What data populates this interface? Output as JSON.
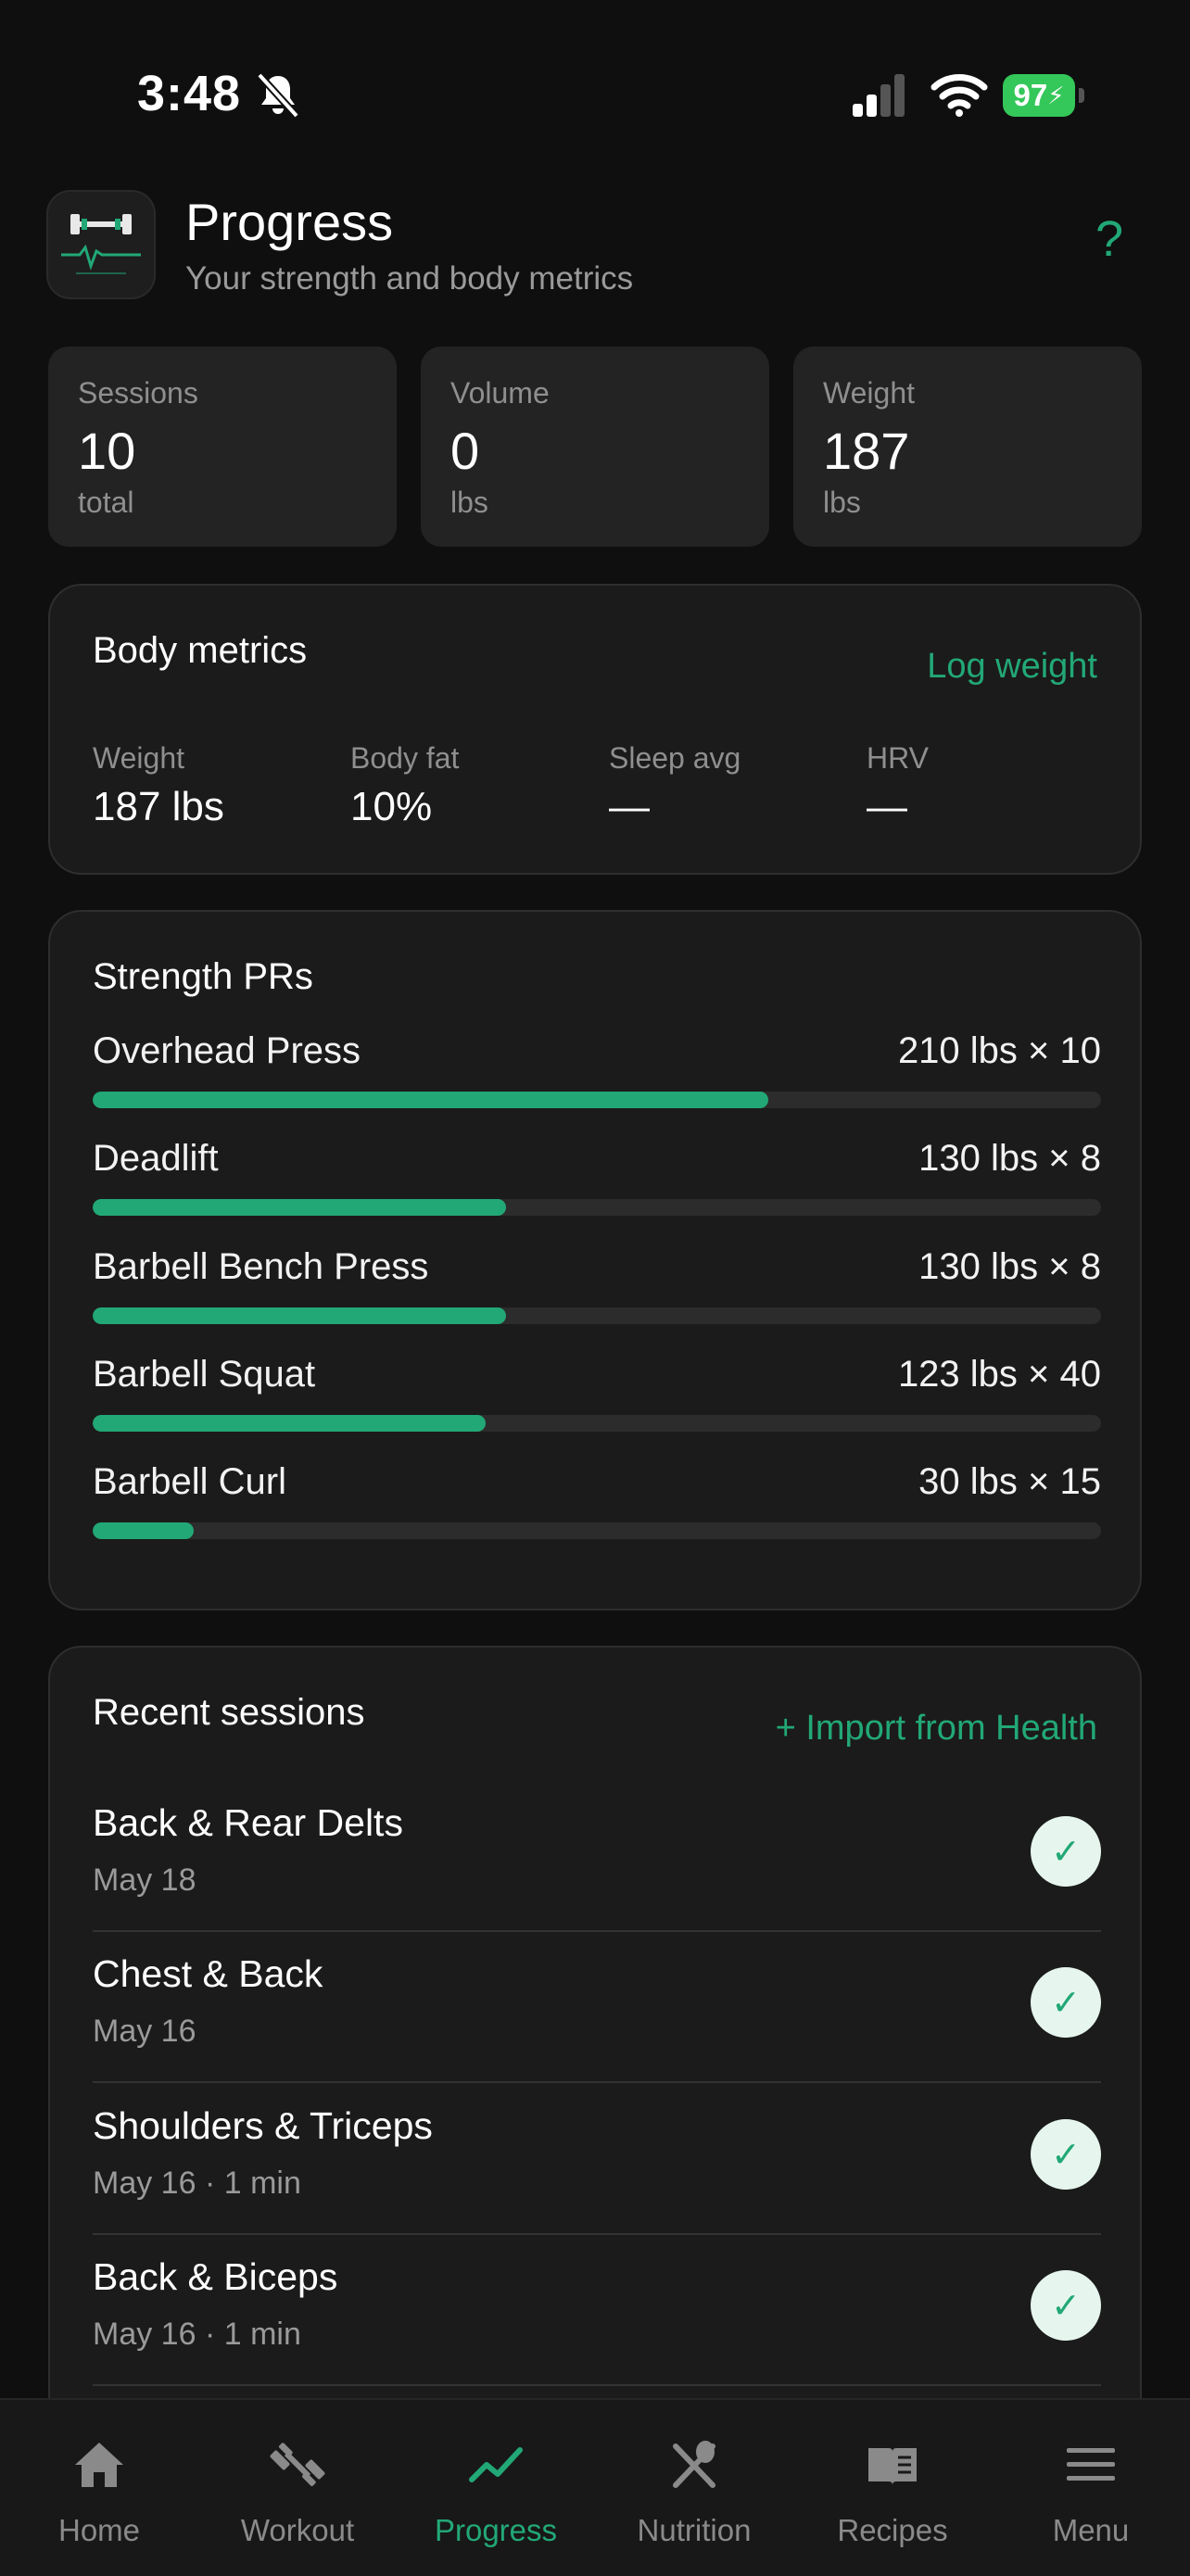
{
  "status_bar": {
    "time": "3:48",
    "battery": "97"
  },
  "header": {
    "title": "Progress",
    "subtitle": "Your strength and body metrics",
    "help": "?"
  },
  "stats": [
    {
      "label": "Sessions",
      "value": "10",
      "unit": "total"
    },
    {
      "label": "Volume",
      "value": "0",
      "unit": "lbs"
    },
    {
      "label": "Weight",
      "value": "187",
      "unit": "lbs"
    }
  ],
  "body_metrics": {
    "title": "Body metrics",
    "action": "Log weight",
    "items": [
      {
        "label": "Weight",
        "value": "187 lbs"
      },
      {
        "label": "Body fat",
        "value": "10%"
      },
      {
        "label": "Sleep avg",
        "value": "—"
      },
      {
        "label": "HRV",
        "value": "—"
      }
    ]
  },
  "strength_prs": {
    "title": "Strength PRs",
    "items": [
      {
        "name": "Overhead Press",
        "value": "210 lbs × 10",
        "progress": 0.67
      },
      {
        "name": "Deadlift",
        "value": "130 lbs × 8",
        "progress": 0.41
      },
      {
        "name": "Barbell Bench Press",
        "value": "130 lbs × 8",
        "progress": 0.41
      },
      {
        "name": "Barbell Squat",
        "value": "123 lbs × 40",
        "progress": 0.39
      },
      {
        "name": "Barbell Curl",
        "value": "30 lbs × 15",
        "progress": 0.1
      }
    ]
  },
  "recent_sessions": {
    "title": "Recent sessions",
    "action": "+ Import from Health",
    "items": [
      {
        "title": "Back & Rear Delts",
        "meta": "May 18",
        "check": "✓"
      },
      {
        "title": "Chest & Back",
        "meta": "May 16",
        "check": "✓"
      },
      {
        "title": "Shoulders & Triceps",
        "meta": "May 16 · 1 min",
        "check": "✓"
      },
      {
        "title": "Back & Biceps",
        "meta": "May 16 · 1 min",
        "check": "✓"
      }
    ]
  },
  "tab_bar": {
    "tabs": [
      {
        "label": "Home",
        "icon": "home-icon"
      },
      {
        "label": "Workout",
        "icon": "dumbbell-icon"
      },
      {
        "label": "Progress",
        "icon": "trend-icon",
        "active": true
      },
      {
        "label": "Nutrition",
        "icon": "utensils-icon"
      },
      {
        "label": "Recipes",
        "icon": "book-icon"
      },
      {
        "label": "Menu",
        "icon": "menu-icon"
      }
    ]
  },
  "colors": {
    "accent": "#22a877",
    "background": "#0f0f0f",
    "card": "#232323",
    "battery": "#34c759"
  }
}
